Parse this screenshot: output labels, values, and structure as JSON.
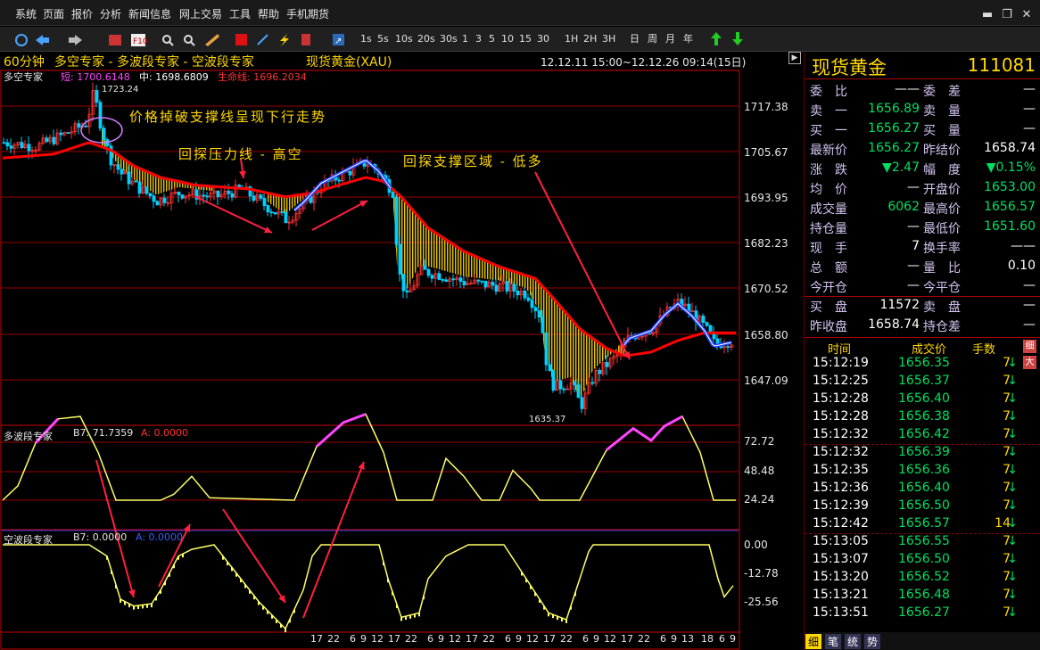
{
  "menu": [
    "系统",
    "页面",
    "报价",
    "分析",
    "新闻信息",
    "网上交易",
    "工具",
    "帮助",
    "手机期货"
  ],
  "toolbar": {
    "periods": [
      "1s",
      "5s",
      "10s",
      "20s",
      "30s",
      "1",
      "3",
      "5",
      "10",
      "15",
      "30",
      "1H",
      "2H",
      "3H",
      "日",
      "周",
      "月",
      "年"
    ]
  },
  "chart": {
    "header": {
      "period": "60分钟",
      "title": "多空专家 - 多波段专家 - 空波段专家",
      "symbol": "现货黄金(XAU)",
      "range": "12.12.11 15:00~12.12.26 09:14(15日)"
    },
    "legend": {
      "name": "多空专家",
      "short_label": "短: 1700.6148",
      "mid_label": "中: 1698.6809",
      "life_label": "生命线: 1696.2034"
    },
    "annotations": {
      "breakdown": "价格掉破支撑线呈现下行走势",
      "resistance": "回探压力线 - 高空",
      "support": "回探支撑区域 - 低多"
    },
    "high_label": "1723.24",
    "low_label": "1635.37",
    "main_ticks": [
      "1717.38",
      "1705.67",
      "1693.95",
      "1682.23",
      "1670.52",
      "1658.80",
      "1647.09"
    ],
    "sub1": {
      "name": "多波段专家",
      "b7": "B7: 71.7359",
      "a": "A: 0.0000",
      "ticks": [
        "72.72",
        "48.48",
        "24.24"
      ]
    },
    "sub2": {
      "name": "空波段专家",
      "b7": "B7: 0.0000",
      "a": "A: 0.0000",
      "ticks": [
        "0.00",
        "-12.78",
        "-25.56"
      ]
    },
    "x_ticks": [
      "17",
      "22",
      "6",
      "9",
      "12",
      "17",
      "22",
      "6",
      "9",
      "12",
      "17",
      "22",
      "6",
      "9",
      "12",
      "17",
      "22",
      "6",
      "9",
      "12",
      "17",
      "22",
      "6",
      "9",
      "13",
      "18",
      "6",
      "9"
    ],
    "colors": {
      "price_up": "#ff3333",
      "price_down": "#00d0ff",
      "life_line": "#ff0000",
      "short_line": "#ffffff",
      "mid_line": "#2040ff",
      "fill": "#ffd700",
      "grid": "#990000",
      "wave": "#ffff66",
      "wave_hi": "#ff44ff"
    }
  },
  "quote": {
    "name": "现货黄金",
    "code": "111081",
    "rows": [
      {
        "l1": "委　比",
        "v1": "——",
        "l2": "委　差",
        "v2": "—"
      },
      {
        "l1": "卖　一",
        "v1": "1656.89",
        "l2": "卖　量",
        "v2": "—"
      },
      {
        "l1": "买　一",
        "v1": "1656.27",
        "l2": "买　量",
        "v2": "—"
      },
      {
        "l1": "最新价",
        "v1": "1656.27",
        "l2": "昨结价",
        "v2": "1658.74"
      },
      {
        "l1": "涨　跌",
        "v1": "▼2.47",
        "l2": "幅　度",
        "v2": "▼0.15%"
      },
      {
        "l1": "均　价",
        "v1": "—",
        "l2": "开盘价",
        "v2": "1653.00"
      },
      {
        "l1": "成交量",
        "v1": "6062",
        "l2": "最高价",
        "v2": "1656.57"
      },
      {
        "l1": "持仓量",
        "v1": "—",
        "l2": "最低价",
        "v2": "1651.60"
      },
      {
        "l1": "现　手",
        "v1": "7",
        "l2": "换手率",
        "v2": "——"
      },
      {
        "l1": "总　额",
        "v1": "—",
        "l2": "量　比",
        "v2": "0.10"
      },
      {
        "l1": "今开仓",
        "v1": "—",
        "l2": "今平仓",
        "v2": "—"
      },
      {
        "l1": "买　盘",
        "v1": "11572",
        "l2": "卖　盘",
        "v2": "—"
      },
      {
        "l1": "昨收盘",
        "v1": "1658.74",
        "l2": "持仓差",
        "v2": "—"
      }
    ],
    "trade_header": {
      "time": "时间",
      "price": "成交价",
      "vol": "手数"
    },
    "side_tabs": [
      "细",
      "大"
    ],
    "trades": [
      {
        "t": "15:12:19",
        "p": "1656.35",
        "v": "7"
      },
      {
        "t": "15:12:25",
        "p": "1656.37",
        "v": "7"
      },
      {
        "t": "15:12:28",
        "p": "1656.40",
        "v": "7"
      },
      {
        "t": "15:12:28",
        "p": "1656.38",
        "v": "7"
      },
      {
        "t": "15:12:32",
        "p": "1656.42",
        "v": "7"
      },
      {
        "t": "15:12:32",
        "p": "1656.39",
        "v": "7"
      },
      {
        "t": "15:12:35",
        "p": "1656.36",
        "v": "7"
      },
      {
        "t": "15:12:36",
        "p": "1656.40",
        "v": "7"
      },
      {
        "t": "15:12:39",
        "p": "1656.50",
        "v": "7"
      },
      {
        "t": "15:12:42",
        "p": "1656.57",
        "v": "14"
      },
      {
        "t": "15:13:05",
        "p": "1656.55",
        "v": "7"
      },
      {
        "t": "15:13:07",
        "p": "1656.50",
        "v": "7"
      },
      {
        "t": "15:13:20",
        "p": "1656.52",
        "v": "7"
      },
      {
        "t": "15:13:21",
        "p": "1656.48",
        "v": "7"
      },
      {
        "t": "15:13:51",
        "p": "1656.27",
        "v": "7"
      }
    ],
    "bottom_tabs": [
      "细",
      "笔",
      "统",
      "势"
    ]
  }
}
